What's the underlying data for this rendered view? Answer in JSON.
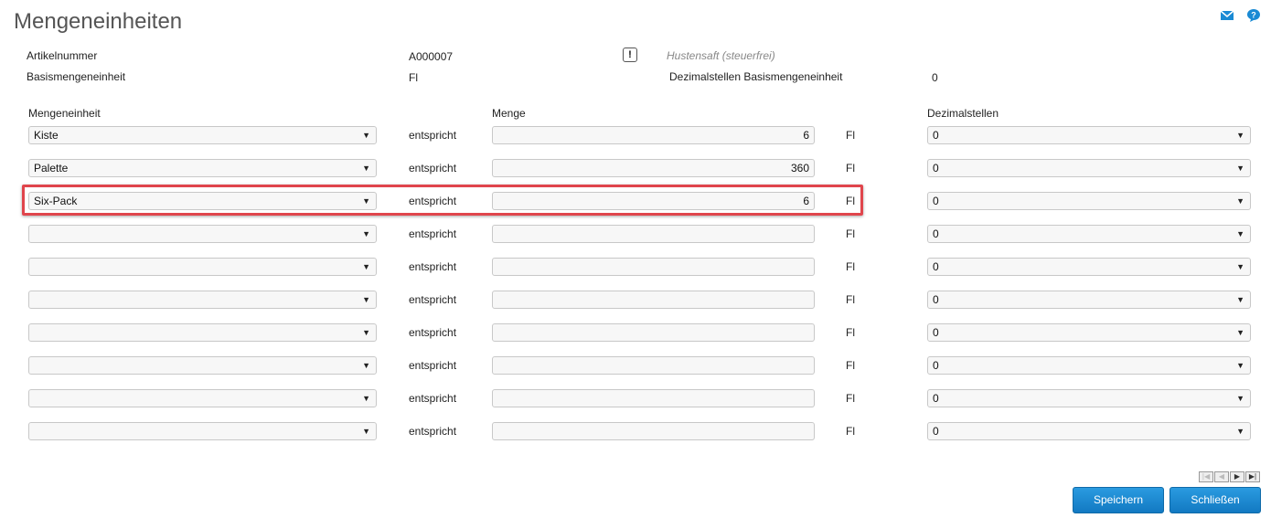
{
  "page": {
    "title": "Mengeneinheiten"
  },
  "header": {
    "article_number_label": "Artikelnummer",
    "article_number_value": "A000007",
    "article_name": "Hustensaft (steuerfrei)",
    "base_unit_label": "Basismengeneinheit",
    "base_unit_value": "Fl",
    "decimal_base_label": "Dezimalstellen Basismengeneinheit",
    "decimal_base_value": "0"
  },
  "columns": {
    "unit": "Mengeneinheit",
    "quantity": "Menge",
    "decimals": "Dezimalstellen"
  },
  "rows": [
    {
      "unit": "Kiste",
      "equals": "entspricht",
      "quantity": "6",
      "base_unit": "Fl",
      "decimals": "0"
    },
    {
      "unit": "Palette",
      "equals": "entspricht",
      "quantity": "360",
      "base_unit": "Fl",
      "decimals": "0"
    },
    {
      "unit": "Six-Pack",
      "equals": "entspricht",
      "quantity": "6",
      "base_unit": "Fl",
      "decimals": "0"
    },
    {
      "unit": "",
      "equals": "entspricht",
      "quantity": "",
      "base_unit": "Fl",
      "decimals": "0"
    },
    {
      "unit": "",
      "equals": "entspricht",
      "quantity": "",
      "base_unit": "Fl",
      "decimals": "0"
    },
    {
      "unit": "",
      "equals": "entspricht",
      "quantity": "",
      "base_unit": "Fl",
      "decimals": "0"
    },
    {
      "unit": "",
      "equals": "entspricht",
      "quantity": "",
      "base_unit": "Fl",
      "decimals": "0"
    },
    {
      "unit": "",
      "equals": "entspricht",
      "quantity": "",
      "base_unit": "Fl",
      "decimals": "0"
    },
    {
      "unit": "",
      "equals": "entspricht",
      "quantity": "",
      "base_unit": "Fl",
      "decimals": "0"
    },
    {
      "unit": "",
      "equals": "entspricht",
      "quantity": "",
      "base_unit": "Fl",
      "decimals": "0"
    }
  ],
  "buttons": {
    "save": "Speichern",
    "close": "Schließen"
  },
  "icons": {
    "mail": "mail-icon",
    "help": "help-icon",
    "info": "exclamation-icon"
  },
  "colors": {
    "accent": "#1a8ad4",
    "highlight": "#e0454c"
  }
}
